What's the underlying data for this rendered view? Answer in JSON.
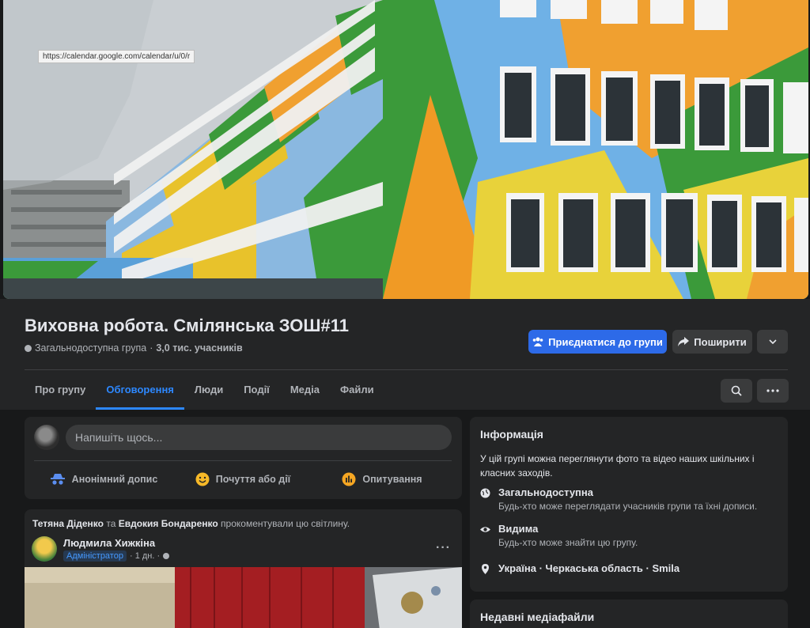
{
  "cover": {
    "tooltip_url": "https://calendar.google.com/calendar/u/0/r"
  },
  "group": {
    "title": "Виховна робота. Смілянська ЗОШ#11",
    "privacy": "Загальнодоступна група",
    "separator": "·",
    "members": "3,0 тис. учасників"
  },
  "actions": {
    "join": "Приєднатися до групи",
    "share": "Поширити"
  },
  "tabs": [
    {
      "label": "Про групу"
    },
    {
      "label": "Обговорення"
    },
    {
      "label": "Люди"
    },
    {
      "label": "Події"
    },
    {
      "label": "Медіа"
    },
    {
      "label": "Файли"
    }
  ],
  "composer": {
    "placeholder": "Напишіть щось...",
    "anon": "Анонімний допис",
    "feeling": "Почуття або дії",
    "poll": "Опитування"
  },
  "post": {
    "actor1": "Тетяна Діденко",
    "conj": "та",
    "actor2": "Евдокия Бондаренко",
    "action": "прокоментували цю світлину.",
    "author": "Людмила Хижкіна",
    "role": "Адміністратор",
    "time": "· 1 дн. ·"
  },
  "info": {
    "title": "Інформація",
    "description": "У цій групі можна переглянути фото та відео наших шкільних і класних заходів.",
    "public_title": "Загальнодоступна",
    "public_sub": "Будь-хто може переглядати учасників групи та їхні дописи.",
    "visible_title": "Видима",
    "visible_sub": "Будь-хто може знайти цю групу.",
    "location": "Україна · Черкаська область · Smila"
  },
  "recent": {
    "title": "Недавні медіафайли"
  },
  "colors": {
    "accent": "#2d88ff",
    "join_button": "#2d6ae8",
    "background": "#18191a",
    "card": "#242526"
  }
}
